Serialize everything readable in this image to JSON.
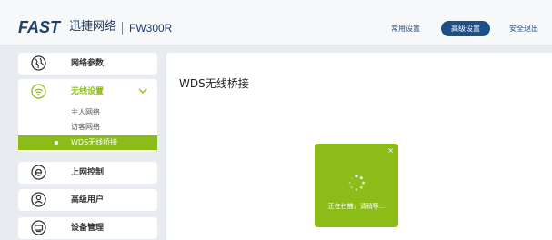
{
  "header": {
    "logo_brand": "FAST",
    "logo_cn": "迅捷网络",
    "model": "FW300R",
    "nav": {
      "common": "常用设置",
      "advanced": "高级设置",
      "exit": "安全退出"
    }
  },
  "sidebar": {
    "items": [
      {
        "label": "网络参数",
        "icon": "globe-icon"
      },
      {
        "label": "无线设置",
        "icon": "wifi-icon"
      },
      {
        "label": "上网控制",
        "icon": "ie-icon"
      },
      {
        "label": "高级用户",
        "icon": "user-icon"
      },
      {
        "label": "设备管理",
        "icon": "device-icon"
      }
    ],
    "wireless_sub": [
      {
        "label": "主人网络"
      },
      {
        "label": "访客网络"
      },
      {
        "label": "WDS无线桥接"
      }
    ]
  },
  "main": {
    "title": "WDS无线桥接"
  },
  "toast": {
    "close": "×",
    "message": "正在扫描，请稍等..."
  },
  "colors": {
    "brand": "#1e3d6b",
    "accent": "#8cbc18",
    "nav_active": "#1e4f87"
  }
}
